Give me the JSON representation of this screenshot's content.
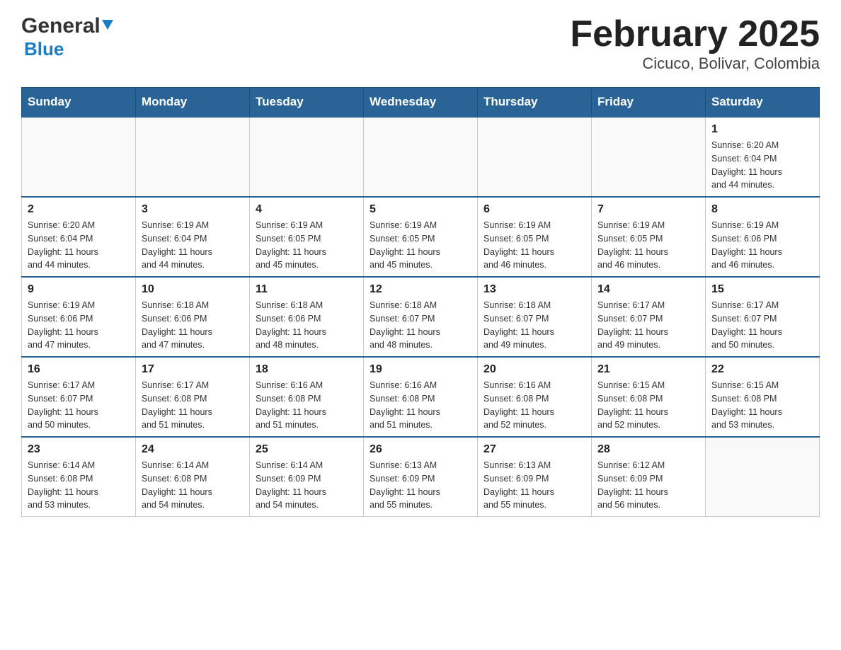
{
  "logo": {
    "general": "General",
    "blue": "Blue"
  },
  "title": "February 2025",
  "subtitle": "Cicuco, Bolivar, Colombia",
  "days_of_week": [
    "Sunday",
    "Monday",
    "Tuesday",
    "Wednesday",
    "Thursday",
    "Friday",
    "Saturday"
  ],
  "weeks": [
    [
      {
        "day": "",
        "info": ""
      },
      {
        "day": "",
        "info": ""
      },
      {
        "day": "",
        "info": ""
      },
      {
        "day": "",
        "info": ""
      },
      {
        "day": "",
        "info": ""
      },
      {
        "day": "",
        "info": ""
      },
      {
        "day": "1",
        "info": "Sunrise: 6:20 AM\nSunset: 6:04 PM\nDaylight: 11 hours\nand 44 minutes."
      }
    ],
    [
      {
        "day": "2",
        "info": "Sunrise: 6:20 AM\nSunset: 6:04 PM\nDaylight: 11 hours\nand 44 minutes."
      },
      {
        "day": "3",
        "info": "Sunrise: 6:19 AM\nSunset: 6:04 PM\nDaylight: 11 hours\nand 44 minutes."
      },
      {
        "day": "4",
        "info": "Sunrise: 6:19 AM\nSunset: 6:05 PM\nDaylight: 11 hours\nand 45 minutes."
      },
      {
        "day": "5",
        "info": "Sunrise: 6:19 AM\nSunset: 6:05 PM\nDaylight: 11 hours\nand 45 minutes."
      },
      {
        "day": "6",
        "info": "Sunrise: 6:19 AM\nSunset: 6:05 PM\nDaylight: 11 hours\nand 46 minutes."
      },
      {
        "day": "7",
        "info": "Sunrise: 6:19 AM\nSunset: 6:05 PM\nDaylight: 11 hours\nand 46 minutes."
      },
      {
        "day": "8",
        "info": "Sunrise: 6:19 AM\nSunset: 6:06 PM\nDaylight: 11 hours\nand 46 minutes."
      }
    ],
    [
      {
        "day": "9",
        "info": "Sunrise: 6:19 AM\nSunset: 6:06 PM\nDaylight: 11 hours\nand 47 minutes."
      },
      {
        "day": "10",
        "info": "Sunrise: 6:18 AM\nSunset: 6:06 PM\nDaylight: 11 hours\nand 47 minutes."
      },
      {
        "day": "11",
        "info": "Sunrise: 6:18 AM\nSunset: 6:06 PM\nDaylight: 11 hours\nand 48 minutes."
      },
      {
        "day": "12",
        "info": "Sunrise: 6:18 AM\nSunset: 6:07 PM\nDaylight: 11 hours\nand 48 minutes."
      },
      {
        "day": "13",
        "info": "Sunrise: 6:18 AM\nSunset: 6:07 PM\nDaylight: 11 hours\nand 49 minutes."
      },
      {
        "day": "14",
        "info": "Sunrise: 6:17 AM\nSunset: 6:07 PM\nDaylight: 11 hours\nand 49 minutes."
      },
      {
        "day": "15",
        "info": "Sunrise: 6:17 AM\nSunset: 6:07 PM\nDaylight: 11 hours\nand 50 minutes."
      }
    ],
    [
      {
        "day": "16",
        "info": "Sunrise: 6:17 AM\nSunset: 6:07 PM\nDaylight: 11 hours\nand 50 minutes."
      },
      {
        "day": "17",
        "info": "Sunrise: 6:17 AM\nSunset: 6:08 PM\nDaylight: 11 hours\nand 51 minutes."
      },
      {
        "day": "18",
        "info": "Sunrise: 6:16 AM\nSunset: 6:08 PM\nDaylight: 11 hours\nand 51 minutes."
      },
      {
        "day": "19",
        "info": "Sunrise: 6:16 AM\nSunset: 6:08 PM\nDaylight: 11 hours\nand 51 minutes."
      },
      {
        "day": "20",
        "info": "Sunrise: 6:16 AM\nSunset: 6:08 PM\nDaylight: 11 hours\nand 52 minutes."
      },
      {
        "day": "21",
        "info": "Sunrise: 6:15 AM\nSunset: 6:08 PM\nDaylight: 11 hours\nand 52 minutes."
      },
      {
        "day": "22",
        "info": "Sunrise: 6:15 AM\nSunset: 6:08 PM\nDaylight: 11 hours\nand 53 minutes."
      }
    ],
    [
      {
        "day": "23",
        "info": "Sunrise: 6:14 AM\nSunset: 6:08 PM\nDaylight: 11 hours\nand 53 minutes."
      },
      {
        "day": "24",
        "info": "Sunrise: 6:14 AM\nSunset: 6:08 PM\nDaylight: 11 hours\nand 54 minutes."
      },
      {
        "day": "25",
        "info": "Sunrise: 6:14 AM\nSunset: 6:09 PM\nDaylight: 11 hours\nand 54 minutes."
      },
      {
        "day": "26",
        "info": "Sunrise: 6:13 AM\nSunset: 6:09 PM\nDaylight: 11 hours\nand 55 minutes."
      },
      {
        "day": "27",
        "info": "Sunrise: 6:13 AM\nSunset: 6:09 PM\nDaylight: 11 hours\nand 55 minutes."
      },
      {
        "day": "28",
        "info": "Sunrise: 6:12 AM\nSunset: 6:09 PM\nDaylight: 11 hours\nand 56 minutes."
      },
      {
        "day": "",
        "info": ""
      }
    ]
  ]
}
